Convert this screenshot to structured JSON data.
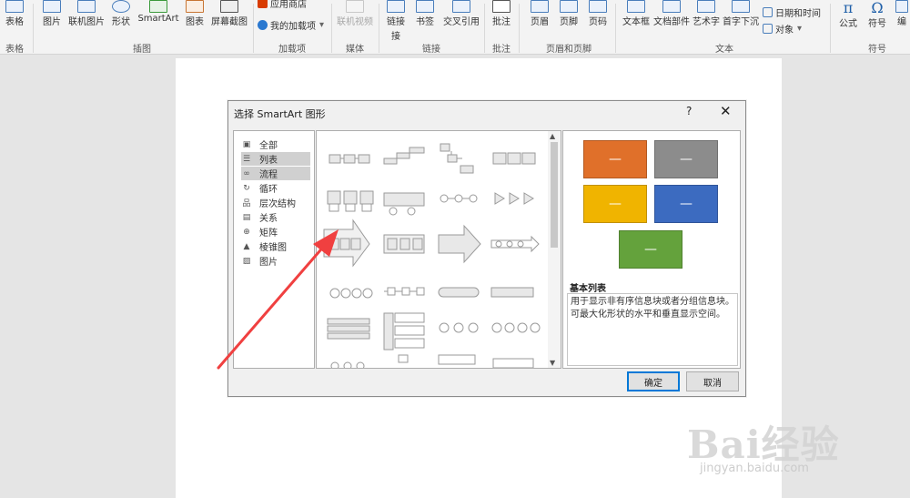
{
  "ribbon": {
    "buttons": {
      "table": "表格",
      "picture": "图片",
      "online_picture": "联机图片",
      "shapes": "形状",
      "smartart": "SmartArt",
      "chart": "图表",
      "screenshot": "屏幕截图",
      "online_video": "联机视频",
      "link": "链接",
      "link_wrap": "接",
      "bookmark": "书签",
      "cross_ref": "交叉引用",
      "comment": "批注",
      "header": "页眉",
      "footer": "页脚",
      "page_number": "页码",
      "textbox": "文本框",
      "quick_parts": "文档部件",
      "wordart": "艺术字",
      "drop_cap": "首字下沉",
      "formula": "公式",
      "symbol": "符号",
      "numbering": "编"
    },
    "small": {
      "store": "应用商店",
      "my_addins": "我的加载项",
      "datetime": "日期和时间",
      "object": "对象"
    },
    "groups": {
      "tables": "表格",
      "illustrations": "插图",
      "addins": "加载项",
      "media": "媒体",
      "links": "链接",
      "comments": "批注",
      "header_footer": "页眉和页脚",
      "text": "文本",
      "symbols": "符号"
    }
  },
  "dialog": {
    "title": "选择 SmartArt 图形",
    "help": "?",
    "close": "✕",
    "categories": [
      {
        "label": "全部",
        "icon": "all-icon"
      },
      {
        "label": "列表",
        "icon": "list-icon"
      },
      {
        "label": "流程",
        "icon": "process-icon"
      },
      {
        "label": "循环",
        "icon": "cycle-icon"
      },
      {
        "label": "层次结构",
        "icon": "hierarchy-icon"
      },
      {
        "label": "关系",
        "icon": "relationship-icon"
      },
      {
        "label": "矩阵",
        "icon": "matrix-icon"
      },
      {
        "label": "棱锥图",
        "icon": "pyramid-icon"
      },
      {
        "label": "图片",
        "icon": "picture-icon"
      }
    ],
    "preview": {
      "name": "基本列表",
      "description": "用于显示非有序信息块或者分组信息块。可最大化形状的水平和垂直显示空间。",
      "colors": [
        "#e0702a",
        "#8c8c8c",
        "#f0b400",
        "#3c6bc0",
        "#64a23c"
      ],
      "box_label": "—"
    },
    "ok": "确定",
    "cancel": "取消"
  },
  "watermark": {
    "logo": "Bai经验",
    "url": "jingyan.baidu.com"
  }
}
